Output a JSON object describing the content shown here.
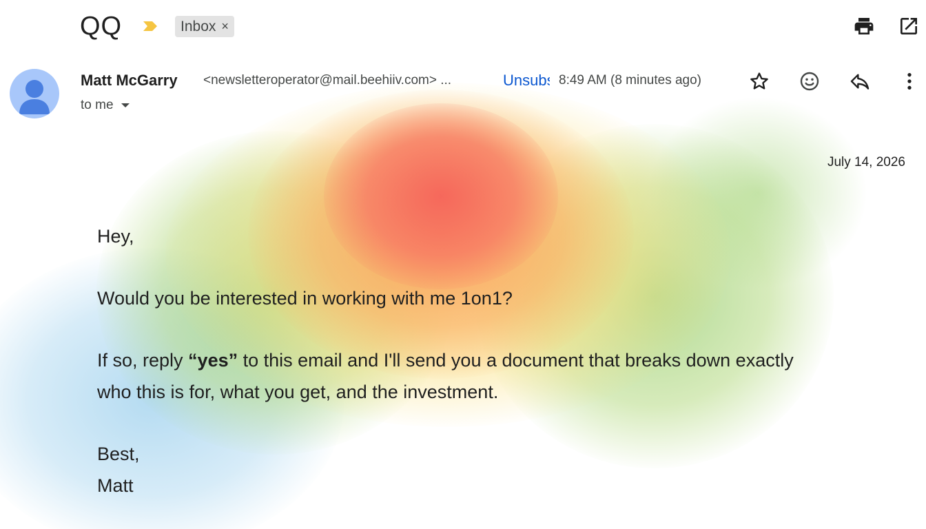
{
  "email": {
    "subject": "QQ",
    "label": "Inbox",
    "label_remove": "×",
    "sender": {
      "name": "Matt McGarry",
      "email": "<newsletteroperator@mail.beehiiv.com> ...",
      "unsubscribe": "Unsubscribe",
      "time": "8:49 AM (8 minutes ago)",
      "recipient": "to me"
    },
    "date": "July 14, 2026",
    "body": {
      "greeting": "Hey,",
      "question": "Would you be interested in working with me 1on1?",
      "offer_prefix": "If so, reply ",
      "offer_bold": "“yes”",
      "offer_line1_suffix": " to this email and I'll send you a document that breaks down exactly",
      "offer_line2": "who this is for, what you get, and the investment.",
      "signoff": "Best,",
      "signature": "Matt"
    }
  },
  "icons": {
    "importance": "importance-marker-icon",
    "print": "print-icon",
    "open_new_window": "open-in-new-window-icon",
    "star": "star-icon",
    "emoji": "emoji-reaction-icon",
    "reply": "reply-icon",
    "more": "more-vert-icon",
    "dropdown": "caret-down-icon"
  },
  "colors": {
    "link_blue": "#0b57d0",
    "importance_yellow": "#f5c542",
    "avatar_bg": "#a8c7fa",
    "avatar_fg": "#4a7fe0",
    "chip_bg": "#e3e3e3"
  }
}
